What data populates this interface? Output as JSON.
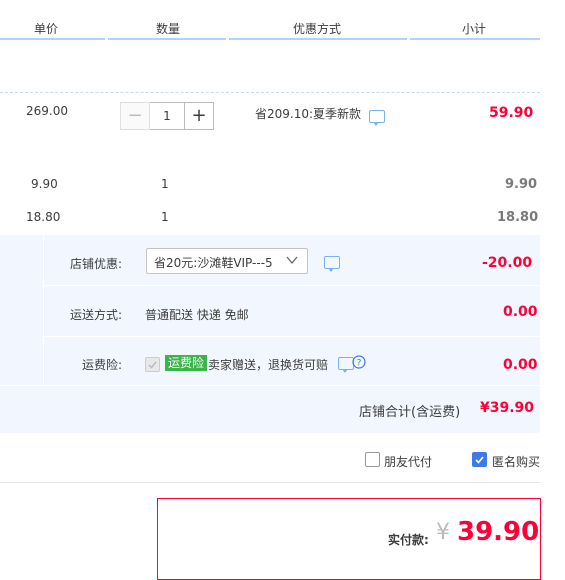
{
  "header": {
    "col_price": "单价",
    "col_qty": "数量",
    "col_discount": "优惠方式",
    "col_subtotal": "小计"
  },
  "items": [
    {
      "price": "269.00",
      "qty": "1",
      "discount": "省209.10:夏季新款",
      "subtotal": "59.90"
    },
    {
      "price": "9.90",
      "qty": "1",
      "subtotal": "9.90"
    },
    {
      "price": "18.80",
      "qty": "1",
      "subtotal": "18.80"
    }
  ],
  "stepper": {
    "minus": "−",
    "plus": "+"
  },
  "shop": {
    "discount_label": "店铺优惠:",
    "discount_select": "省20元:沙滩鞋VIP---5",
    "discount_amount": "-20.00",
    "shipping_label": "运送方式:",
    "shipping_value": "普通配送 快递 免邮",
    "shipping_amount": "0.00",
    "insurance_label": "运费险:",
    "insurance_tag": "运费险",
    "insurance_desc": "卖家赠送，退换货可赔",
    "insurance_amount": "0.00",
    "total_label": "店铺合计(含运费)",
    "total_amount": "¥39.90"
  },
  "options": {
    "friend_pay": "朋友代付",
    "anonymous": "匿名购买"
  },
  "payment": {
    "label": "实付款:",
    "currency": "¥",
    "amount": "39.90"
  },
  "colors": {
    "accent_red": "#ff0036",
    "accent_blue": "#3d7ae8",
    "panel_bg": "#f2f7ff"
  }
}
